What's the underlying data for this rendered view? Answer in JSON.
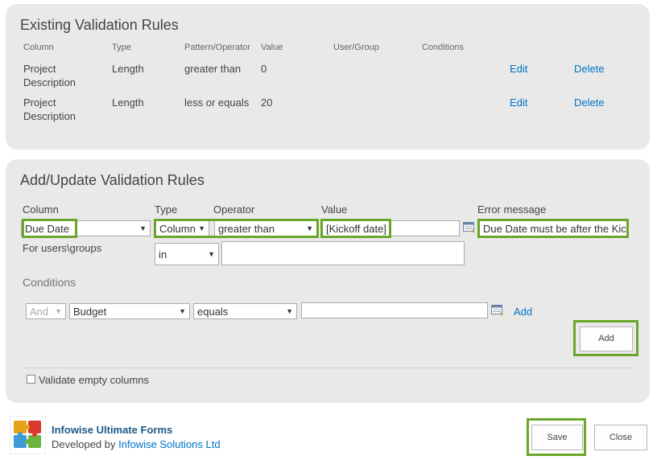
{
  "existing": {
    "title": "Existing Validation Rules",
    "headers": [
      "Column",
      "Type",
      "Pattern/Operator",
      "Value",
      "User/Group",
      "Conditions"
    ],
    "rows": [
      {
        "column_l1": "Project",
        "column_l2": "Description",
        "type": "Length",
        "operator": "greater than",
        "value": "0",
        "edit": "Edit",
        "delete": "Delete"
      },
      {
        "column_l1": "Project",
        "column_l2": "Description",
        "type": "Length",
        "operator": "less or equals",
        "value": "20",
        "edit": "Edit",
        "delete": "Delete"
      }
    ]
  },
  "addupdate": {
    "title": "Add/Update Validation Rules",
    "labels": {
      "column": "Column",
      "type": "Type",
      "operator": "Operator",
      "value": "Value",
      "error": "Error message",
      "users": "For users\\groups",
      "conditions": "Conditions"
    },
    "column_select": "Due Date",
    "type_select": "Column",
    "operator_select": "greater than",
    "value_input": "[Kickoff date]",
    "error_input": "Due Date must be after the Kickoff date",
    "users_select": "in",
    "users_input": "",
    "cond_and": "And",
    "cond_column": "Budget",
    "cond_operator": "equals",
    "cond_value": "",
    "cond_add_link": "Add",
    "add_button": "Add",
    "validate_empty": "Validate empty columns",
    "validate_empty_checked": false
  },
  "footer": {
    "product": "Infowise Ultimate Forms",
    "dev_prefix": "Developed by",
    "dev_link": "Infowise Solutions Ltd",
    "save_button": "Save",
    "close_button": "Close"
  },
  "colors": {
    "accent_highlight": "#6aa62a",
    "link": "#0072c6",
    "panel": "#e9e9e9"
  },
  "icons": {
    "arrow": "▼",
    "lookup": "lookup-icon",
    "logo": "puzzle-logo"
  }
}
